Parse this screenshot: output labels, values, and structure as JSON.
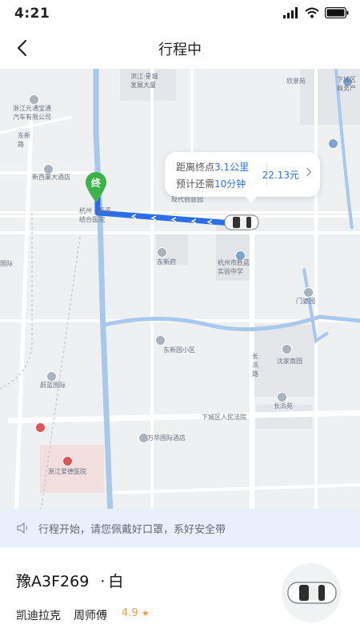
{
  "status_bar": {
    "time": "4:21"
  },
  "nav": {
    "title": "行程中"
  },
  "map": {
    "labels": {
      "binjiang": "滨江·星城\n发展大厦",
      "xinjingyuan": "欣景苑",
      "xiachengqu": "下城区\n商务产",
      "zhejiang_yuantong": "浙江元通宝通\n汽车有限公司",
      "dongxin_road": "东新\n路",
      "xinxiye_hotel": "新西業大酒店",
      "xiandai_chuangyi": "现代创意园",
      "hangzhou_hospital": "杭州   西溪\n结合医院",
      "dongxinfu": "东新府",
      "shengjian_school": "杭州市胜蓝\n实验中学",
      "menjiyuan": "门婆园",
      "international": "国际",
      "dongxinyuan": "东新园小区",
      "changbin_road": "长\n浜\n路",
      "shenjianan": "沈家南园",
      "weilan": "蔚蓝国际",
      "changbinyuan": "长浜苑",
      "court": "下城区人民法院",
      "wanhua_hotel": "万华国际酒店",
      "aide_hospital": "浙江爱德医院"
    },
    "bubble": {
      "distance_prefix": "距离终点",
      "distance_value": "3.1公里",
      "time_prefix": "预计还需",
      "time_value": "10分钟",
      "price": "22.13元"
    },
    "destination_marker": "终"
  },
  "notice": {
    "text": "行程开始，请您佩戴好口罩，系好安全带"
  },
  "driver": {
    "plate": "豫A3F269",
    "color_sep": "·",
    "car_color": "白",
    "car_model": "凯迪拉克",
    "driver_name": "周师傅",
    "rating": "4.9",
    "rating_star": "★"
  },
  "colors": {
    "route": "#2c6ee8",
    "accent": "#2f72e6",
    "rating": "#f39b3b",
    "destination": "#3cb34a"
  }
}
